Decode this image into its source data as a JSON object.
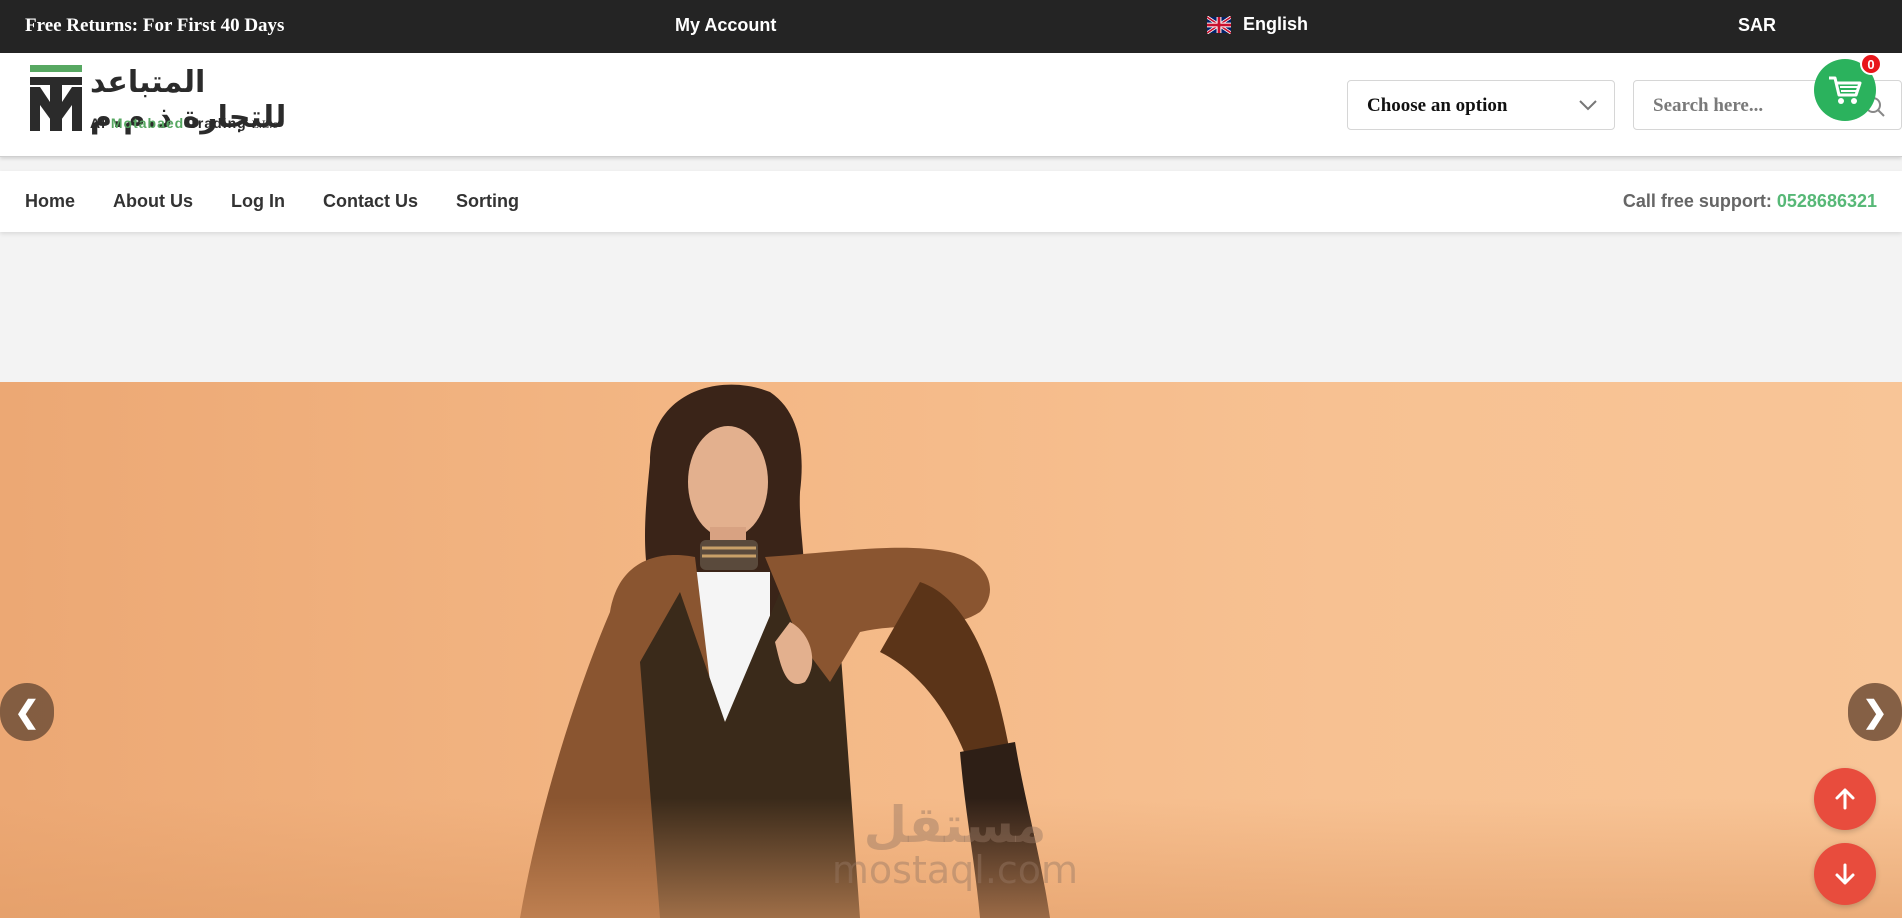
{
  "topbar": {
    "promo": "Free Returns: For First 40 Days",
    "account": "My Account",
    "language": "English",
    "currency": "SAR"
  },
  "logo": {
    "arabic": "المتباعد للتجارة ذ.م.م",
    "latin_1": "Al",
    "latin_2": "Motabaed",
    "latin_3": "Trading",
    "latin_4": "L.L.c"
  },
  "header": {
    "select_value": "Choose an option",
    "search_placeholder": "Search here...",
    "cart_count": "0"
  },
  "nav": {
    "items": [
      {
        "label": "Home"
      },
      {
        "label": "About Us"
      },
      {
        "label": "Log In"
      },
      {
        "label": "Contact Us"
      },
      {
        "label": "Sorting"
      }
    ],
    "support_label": "Call free support:",
    "support_phone": "0528686321"
  },
  "slider": {
    "prev": "❮",
    "next": "❯"
  },
  "watermark": {
    "arabic": "مستقل",
    "latin": "mostaql.com"
  },
  "colors": {
    "topbar": "#242424",
    "accent_green": "#2bb25d",
    "phone_green": "#57b877",
    "fab_red": "#e84c3d",
    "badge_red": "#e8161b",
    "hero_bg": "#f4b886"
  }
}
